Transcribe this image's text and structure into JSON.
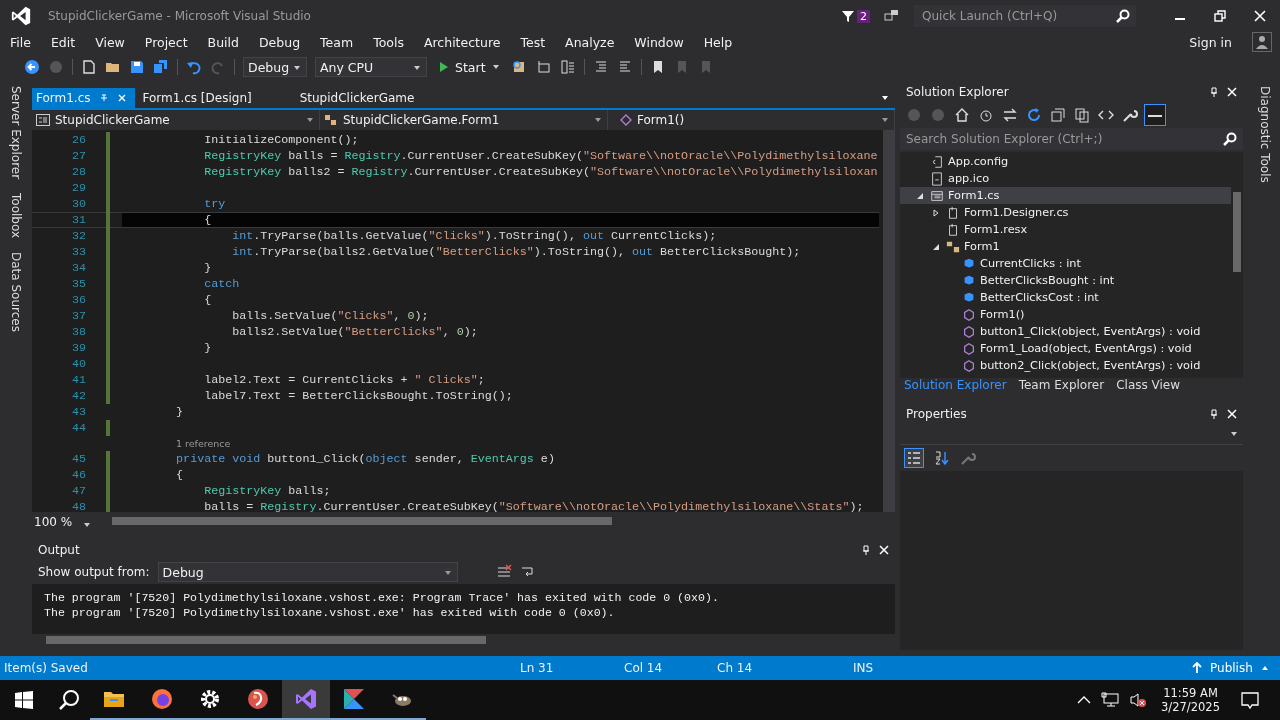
{
  "window": {
    "title": "StupidClickerGame - Microsoft Visual Studio",
    "notification_count": "2",
    "quick_launch_placeholder": "Quick Launch (Ctrl+Q)",
    "account": "Sign in"
  },
  "menu": [
    "File",
    "Edit",
    "View",
    "Project",
    "Build",
    "Debug",
    "Team",
    "Tools",
    "Architecture",
    "Test",
    "Analyze",
    "Window",
    "Help"
  ],
  "toolbar": {
    "configuration": "Debug",
    "platform": "Any CPU",
    "start": "Start"
  },
  "left_tabs": [
    "Server Explorer",
    "Toolbox",
    "Data Sources"
  ],
  "right_tabs": [
    "Diagnostic Tools"
  ],
  "doc_tabs": [
    {
      "label": "Form1.cs",
      "selected": true
    },
    {
      "label": "Form1.cs [Design]",
      "selected": false
    },
    {
      "label": "StupidClickerGame",
      "selected": false
    }
  ],
  "nav_bar": [
    "StupidClickerGame",
    "StupidClickerGame.Form1",
    "Form1()"
  ],
  "editor": {
    "zoom": "100 %",
    "lines": [
      {
        "kind": "code",
        "number": "26",
        "current": false,
        "changed": true,
        "tokens": [
          {
            "text": "            InitializeComponent();",
            "kind": "plain"
          }
        ]
      },
      {
        "kind": "code",
        "number": "27",
        "current": false,
        "changed": true,
        "tokens": [
          {
            "text": "            RegistryKey",
            "kind": "type"
          },
          {
            "text": " balls = ",
            "kind": "plain"
          },
          {
            "text": "Registry",
            "kind": "type"
          },
          {
            "text": ".CurrentUser.CreateSubKey(",
            "kind": "plain"
          },
          {
            "text": "\"Software\\\\notOracle\\\\Polydimethylsiloxane",
            "kind": "string"
          }
        ]
      },
      {
        "kind": "code",
        "number": "28",
        "current": false,
        "changed": true,
        "tokens": [
          {
            "text": "            RegistryKey",
            "kind": "type"
          },
          {
            "text": " balls2 = ",
            "kind": "plain"
          },
          {
            "text": "Registry",
            "kind": "type"
          },
          {
            "text": ".CurrentUser.CreateSubKey(",
            "kind": "plain"
          },
          {
            "text": "\"Software\\\\notOracle\\\\Polydimethylsiloxan",
            "kind": "string"
          }
        ]
      },
      {
        "kind": "code",
        "number": "29",
        "current": false,
        "changed": true
      },
      {
        "kind": "code",
        "number": "30",
        "current": false,
        "changed": true,
        "tokens": [
          {
            "text": "            try",
            "kind": "keyword"
          }
        ]
      },
      {
        "kind": "code",
        "number": "31",
        "current": true,
        "changed": true,
        "tokens": [
          {
            "text": "            {",
            "kind": "plain"
          }
        ]
      },
      {
        "kind": "code",
        "number": "32",
        "current": false,
        "changed": true,
        "tokens": [
          {
            "text": "                int",
            "kind": "keyword"
          },
          {
            "text": ".TryParse(balls.GetValue(",
            "kind": "plain"
          },
          {
            "text": "\"Clicks\"",
            "kind": "string"
          },
          {
            "text": ").ToString(), ",
            "kind": "plain"
          },
          {
            "text": "out",
            "kind": "keyword"
          },
          {
            "text": " CurrentClicks);",
            "kind": "plain"
          }
        ]
      },
      {
        "kind": "code",
        "number": "33",
        "current": false,
        "changed": true,
        "tokens": [
          {
            "text": "                int",
            "kind": "keyword"
          },
          {
            "text": ".TryParse(balls2.GetValue(",
            "kind": "plain"
          },
          {
            "text": "\"BetterClicks\"",
            "kind": "string"
          },
          {
            "text": ").ToString(), ",
            "kind": "plain"
          },
          {
            "text": "out",
            "kind": "keyword"
          },
          {
            "text": " BetterClicksBought);",
            "kind": "plain"
          }
        ]
      },
      {
        "kind": "code",
        "number": "34",
        "current": false,
        "changed": true,
        "tokens": [
          {
            "text": "            }",
            "kind": "plain"
          }
        ]
      },
      {
        "kind": "code",
        "number": "35",
        "current": false,
        "changed": true,
        "tokens": [
          {
            "text": "            catch",
            "kind": "keyword"
          }
        ]
      },
      {
        "kind": "code",
        "number": "36",
        "current": false,
        "changed": true,
        "tokens": [
          {
            "text": "            {",
            "kind": "plain"
          }
        ]
      },
      {
        "kind": "code",
        "number": "37",
        "current": false,
        "changed": true,
        "tokens": [
          {
            "text": "                balls.SetValue(",
            "kind": "plain"
          },
          {
            "text": "\"Clicks\"",
            "kind": "string"
          },
          {
            "text": ", ",
            "kind": "plain"
          },
          {
            "text": "0",
            "kind": "number"
          },
          {
            "text": ");",
            "kind": "plain"
          }
        ]
      },
      {
        "kind": "code",
        "number": "38",
        "current": false,
        "changed": true,
        "tokens": [
          {
            "text": "                balls2.SetValue(",
            "kind": "plain"
          },
          {
            "text": "\"BetterClicks\"",
            "kind": "string"
          },
          {
            "text": ", ",
            "kind": "plain"
          },
          {
            "text": "0",
            "kind": "number"
          },
          {
            "text": ");",
            "kind": "plain"
          }
        ]
      },
      {
        "kind": "code",
        "number": "39",
        "current": false,
        "changed": true,
        "tokens": [
          {
            "text": "            }",
            "kind": "plain"
          }
        ]
      },
      {
        "kind": "code",
        "number": "40",
        "current": false,
        "changed": true
      },
      {
        "kind": "code",
        "number": "41",
        "current": false,
        "changed": true,
        "tokens": [
          {
            "text": "            label2.Text = CurrentClicks + ",
            "kind": "plain"
          },
          {
            "text": "\" Clicks\"",
            "kind": "string"
          },
          {
            "text": ";",
            "kind": "plain"
          }
        ]
      },
      {
        "kind": "code",
        "number": "42",
        "current": false,
        "changed": true,
        "tokens": [
          {
            "text": "            label7.Text = BetterClicksBought.ToString();",
            "kind": "plain"
          }
        ]
      },
      {
        "kind": "code",
        "number": "43",
        "current": false,
        "changed": false,
        "tokens": [
          {
            "text": "        }",
            "kind": "plain"
          }
        ]
      },
      {
        "kind": "code",
        "number": "44",
        "current": false,
        "changed": true
      },
      {
        "kind": "codelens",
        "text": "1 reference"
      },
      {
        "kind": "code",
        "number": "45",
        "current": false,
        "changed": true,
        "tokens": [
          {
            "text": "        private",
            "kind": "keyword"
          },
          {
            "text": " void",
            "kind": "keyword"
          },
          {
            "text": " button1_Click(",
            "kind": "plain"
          },
          {
            "text": "object",
            "kind": "keyword"
          },
          {
            "text": " sender, ",
            "kind": "plain"
          },
          {
            "text": "EventArgs",
            "kind": "type"
          },
          {
            "text": " e)",
            "kind": "plain"
          }
        ]
      },
      {
        "kind": "code",
        "number": "46",
        "current": false,
        "changed": true,
        "tokens": [
          {
            "text": "        {",
            "kind": "plain"
          }
        ]
      },
      {
        "kind": "code",
        "number": "47",
        "current": false,
        "changed": true,
        "tokens": [
          {
            "text": "            RegistryKey",
            "kind": "type"
          },
          {
            "text": " balls;",
            "kind": "plain"
          }
        ]
      },
      {
        "kind": "code",
        "number": "48",
        "current": false,
        "changed": true,
        "tokens": [
          {
            "text": "            balls = ",
            "kind": "plain"
          },
          {
            "text": "Registry",
            "kind": "type"
          },
          {
            "text": ".CurrentUser.CreateSubKey(",
            "kind": "plain"
          },
          {
            "text": "\"Software\\\\notOracle\\\\Polydimethylsiloxane\\\\Stats\"",
            "kind": "string"
          },
          {
            "text": ");",
            "kind": "plain"
          }
        ]
      }
    ]
  },
  "solution_explorer": {
    "title": "Solution Explorer",
    "search_placeholder": "Search Solution Explorer (Ctrl+;)",
    "tree": [
      {
        "label": "App.config",
        "kind": "config",
        "selected": false
      },
      {
        "label": "app.ico",
        "kind": "image",
        "selected": false
      },
      {
        "label": "Form1.cs",
        "kind": "form",
        "selected": true,
        "expanded": true,
        "children": [
          {
            "label": "Form1.Designer.cs",
            "kind": "csfile",
            "selected": false,
            "expanded": false
          },
          {
            "label": "Form1.resx",
            "kind": "csfile",
            "selected": false
          },
          {
            "label": "Form1",
            "kind": "class",
            "selected": false,
            "expanded": true,
            "children": [
              {
                "label": "CurrentClicks : int",
                "kind": "field",
                "selected": false
              },
              {
                "label": "BetterClicksBought : int",
                "kind": "field",
                "selected": false
              },
              {
                "label": "BetterClicksCost : int",
                "kind": "field",
                "selected": false
              },
              {
                "label": "Form1()",
                "kind": "method",
                "selected": false
              },
              {
                "label": "button1_Click(object, EventArgs) : void",
                "kind": "method",
                "selected": false
              },
              {
                "label": "Form1_Load(object, EventArgs) : void",
                "kind": "method",
                "selected": false
              },
              {
                "label": "button2_Click(object, EventArgs) : void",
                "kind": "method",
                "selected": false
              }
            ]
          }
        ]
      }
    ],
    "tabs": [
      {
        "label": "Solution Explorer",
        "selected": true
      },
      {
        "label": "Team Explorer",
        "selected": false
      },
      {
        "label": "Class View",
        "selected": false
      }
    ]
  },
  "properties": {
    "title": "Properties"
  },
  "output": {
    "title": "Output",
    "source_label": "Show output from:",
    "source": "Debug",
    "lines": [
      "The program '[7520] Polydimethylsiloxane.vshost.exe: Program Trace' has exited with code 0 (0x0).",
      "The program '[7520] Polydimethylsiloxane.vshost.exe' has exited with code 0 (0x0)."
    ]
  },
  "status_bar": {
    "message": "Item(s) Saved",
    "line": "Ln 31",
    "column": "Col 14",
    "char": "Ch 14",
    "mode": "INS",
    "publish": "Publish"
  },
  "taskbar": {
    "apps": [
      {
        "kind": "folder",
        "active": false
      },
      {
        "kind": "browser",
        "active": false
      },
      {
        "kind": "gear",
        "active": false
      },
      {
        "kind": "paint",
        "active": false
      },
      {
        "kind": "vs",
        "active": true
      },
      {
        "kind": "ide",
        "active": false
      },
      {
        "kind": "gimp",
        "active": false
      }
    ],
    "time": "11:59 AM",
    "date": "3/27/2025"
  }
}
